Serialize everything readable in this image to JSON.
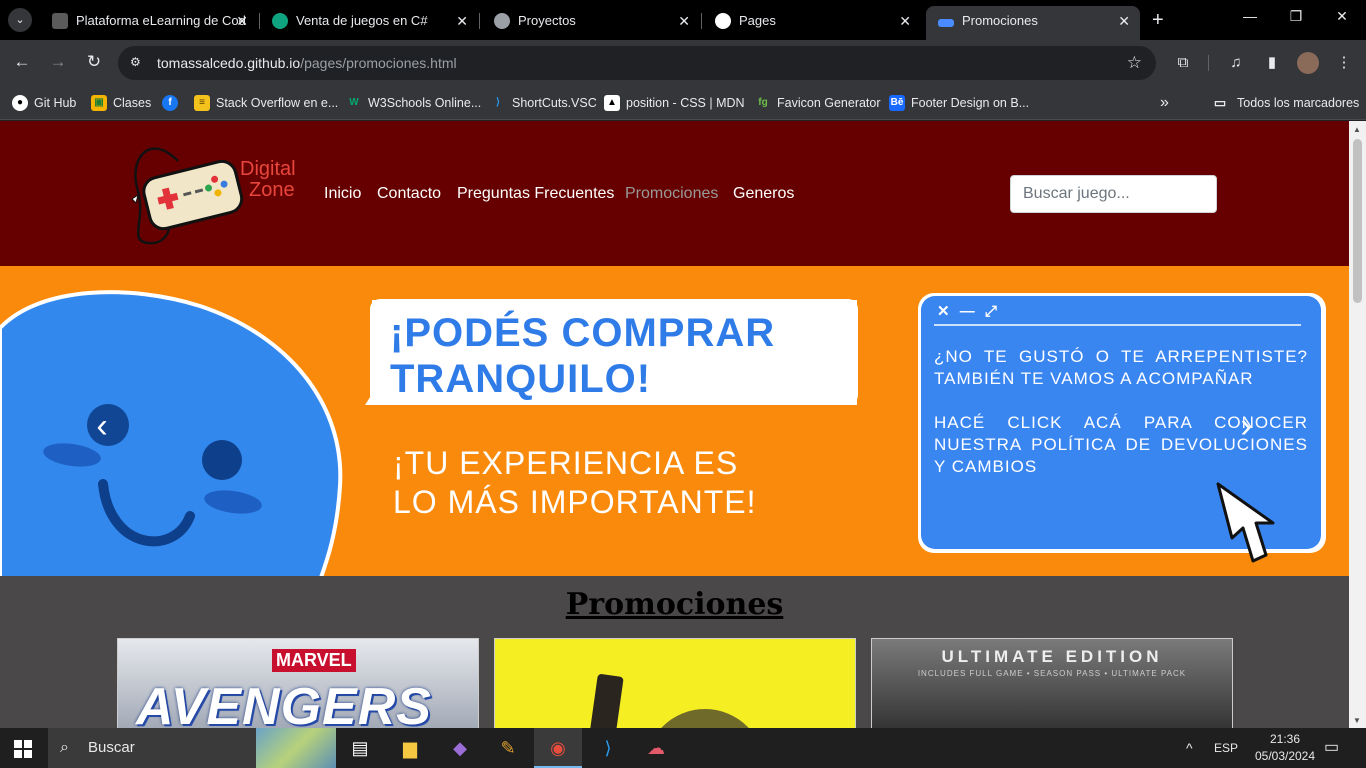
{
  "browser": {
    "tabs": [
      {
        "title": "Plataforma eLearning de Cod",
        "color": "#5b5b5b"
      },
      {
        "title": "Venta de juegos en C#",
        "color": "#10a37f"
      },
      {
        "title": "Proyectos",
        "color": "#9aa0a6"
      },
      {
        "title": "Pages",
        "color": "#ffffff"
      },
      {
        "title": "Promociones",
        "color": "#4a8cff"
      }
    ],
    "url_host": "tomassalcedo.github.io",
    "url_path": "/pages/promociones.html",
    "bookmarks": [
      {
        "label": "Git Hub",
        "icon": "github-icon"
      },
      {
        "label": "Clases",
        "icon": "classroom-icon"
      },
      {
        "label": "",
        "icon": "facebook-icon"
      },
      {
        "label": "Stack Overflow en e...",
        "icon": "stackoverflow-icon"
      },
      {
        "label": "W3Schools Online...",
        "icon": "w3schools-icon"
      },
      {
        "label": "ShortCuts.VSC",
        "icon": "vscode-icon"
      },
      {
        "label": "position - CSS | MDN",
        "icon": "mdn-icon"
      },
      {
        "label": "Favicon Generator",
        "icon": "favicon-generator-icon"
      },
      {
        "label": "Footer Design on B...",
        "icon": "behance-icon"
      }
    ],
    "all_bookmarks": "Todos los marcadores"
  },
  "site": {
    "logo_line1": "Digital",
    "logo_line2": "Zone",
    "nav": [
      "Inicio",
      "Contacto",
      "Preguntas Frecuentes",
      "Promociones",
      "Generos"
    ],
    "nav_current": "Promociones",
    "search_placeholder": "Buscar juego...",
    "banner": {
      "title_line1": "¡PODÉS COMPRAR",
      "title_line2": "TRANQUILO!",
      "sub_line1": "¡TU EXPERIENCIA ES",
      "sub_line2": "LO MÁS IMPORTANTE!",
      "popup_p1": "¿NO TE GUSTÓ O TE ARREPENTISTE? TAMBIÉN TE VAMOS A ACOMPAÑAR",
      "popup_p2": "HACÉ CLICK ACÁ PARA CONOCER NUESTRA POLÍTICA DE DEVOLUCIONES Y CAMBIOS"
    },
    "section_title": "Promociones",
    "cards": [
      {
        "top_text": "MARVEL",
        "main_text": "AVENGERS"
      },
      {
        "top_text": "",
        "main_text": ""
      },
      {
        "top_text": "ULTIMATE EDITION",
        "main_text": "INCLUDES FULL GAME • SEASON PASS • ULTIMATE PACK"
      }
    ]
  },
  "taskbar": {
    "search_label": "Buscar",
    "language": "ESP",
    "time": "21:36",
    "date": "05/03/2024"
  }
}
